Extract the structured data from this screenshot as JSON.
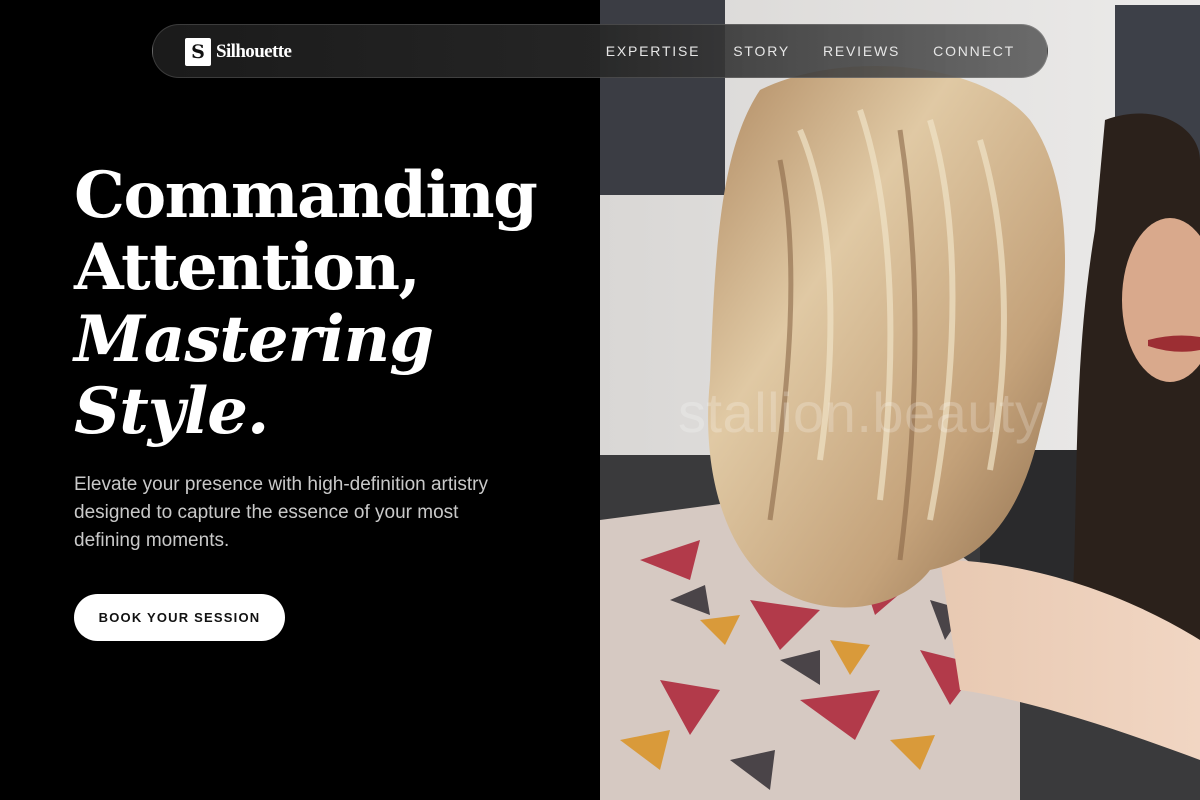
{
  "brand": {
    "mark": "S",
    "name": "Silhouette"
  },
  "nav": {
    "items": [
      {
        "label": "EXPERTISE"
      },
      {
        "label": "STORY"
      },
      {
        "label": "REVIEWS"
      },
      {
        "label": "CONNECT"
      }
    ]
  },
  "hero": {
    "headline_line1": "Commanding",
    "headline_line2": "Attention,",
    "headline_line3": "Mastering",
    "headline_line4": "Style.",
    "subtitle": "Elevate your presence with high-definition artistry designed to capture the essence of your most defining moments.",
    "cta_label": "BOOK YOUR SESSION"
  },
  "photo": {
    "watermark": "stallion.beauty"
  },
  "colors": {
    "background": "#000000",
    "text_primary": "#ffffff",
    "text_secondary": "#c9c9c9",
    "cta_background": "#ffffff"
  }
}
